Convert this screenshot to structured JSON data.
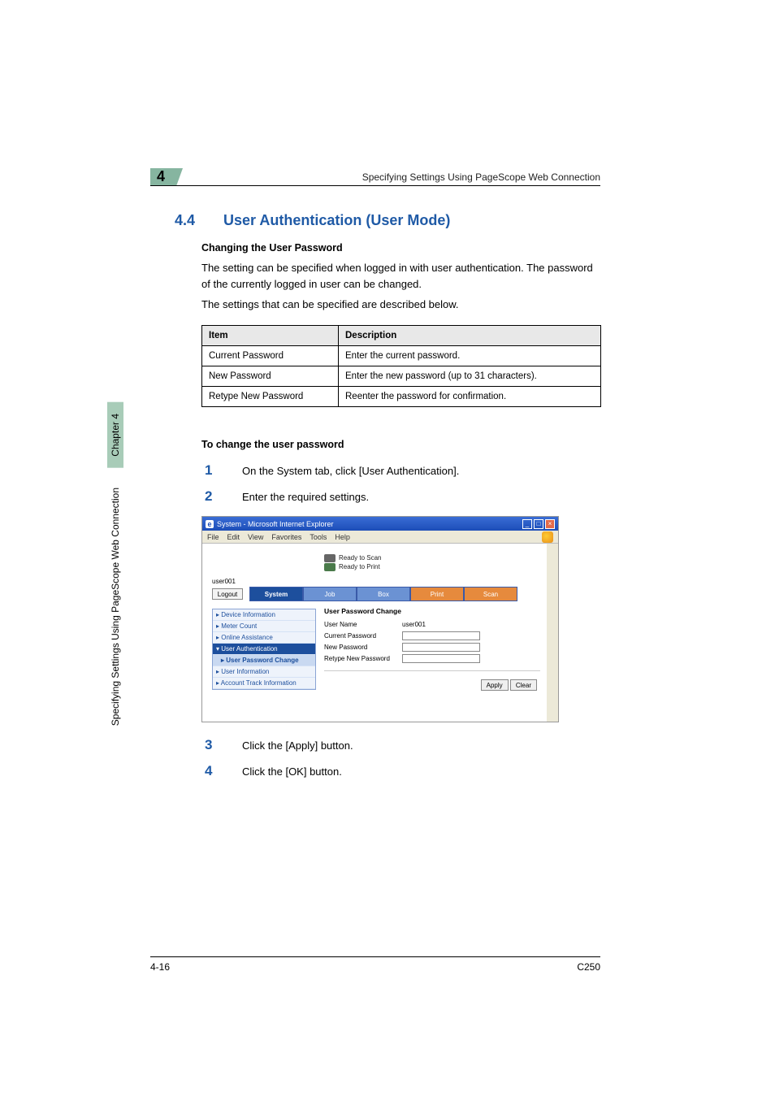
{
  "running_head": "Specifying Settings Using PageScope Web Connection",
  "chapter_badge": "4",
  "section_number": "4.4",
  "section_title": "User Authentication (User Mode)",
  "subhead1": "Changing the User Password",
  "para1": "The setting can be specified when logged in with user authentication. The password of the currently logged in user can be changed.",
  "para2": "The settings that can be specified are described below.",
  "table": {
    "headers": {
      "item": "Item",
      "desc": "Description"
    },
    "rows": [
      {
        "item": "Current Password",
        "desc": "Enter the current password."
      },
      {
        "item": "New Password",
        "desc": "Enter the new password (up to 31 characters)."
      },
      {
        "item": "Retype New Password",
        "desc": "Reenter the password for confirmation."
      }
    ]
  },
  "subhead2": "To change the user password",
  "steps": {
    "s1": {
      "n": "1",
      "t": "On the System tab, click [User Authentication]."
    },
    "s2": {
      "n": "2",
      "t": "Enter the required settings."
    },
    "s3": {
      "n": "3",
      "t": "Click the [Apply] button."
    },
    "s4": {
      "n": "4",
      "t": "Click the [OK] button."
    }
  },
  "side": {
    "chapter": "Chapter 4",
    "title": "Specifying Settings Using PageScope Web Connection"
  },
  "footer": {
    "left": "4-16",
    "right": "C250"
  },
  "shot": {
    "window_title": "System - Microsoft Internet Explorer",
    "ie_menu": [
      "File",
      "Edit",
      "View",
      "Favorites",
      "Tools",
      "Help"
    ],
    "status": {
      "scan": "Ready to Scan",
      "print": "Ready to Print"
    },
    "username": "user001",
    "logout": "Logout",
    "tabs": {
      "system": "System",
      "job": "Job",
      "box": "Box",
      "print": "Print",
      "scan": "Scan"
    },
    "sidebar": {
      "device_info": "Device Information",
      "meter_count": "Meter Count",
      "online_assist": "Online Assistance",
      "user_auth": "User Authentication",
      "user_pwd_change": "User Password Change",
      "user_info": "User Information",
      "account_track": "Account Track Information"
    },
    "content": {
      "heading": "User Password Change",
      "user_name_label": "User Name",
      "user_name_value": "user001",
      "current_pwd": "Current Password",
      "new_pwd": "New Password",
      "retype_pwd": "Retype New Password",
      "apply": "Apply",
      "clear": "Clear"
    }
  }
}
